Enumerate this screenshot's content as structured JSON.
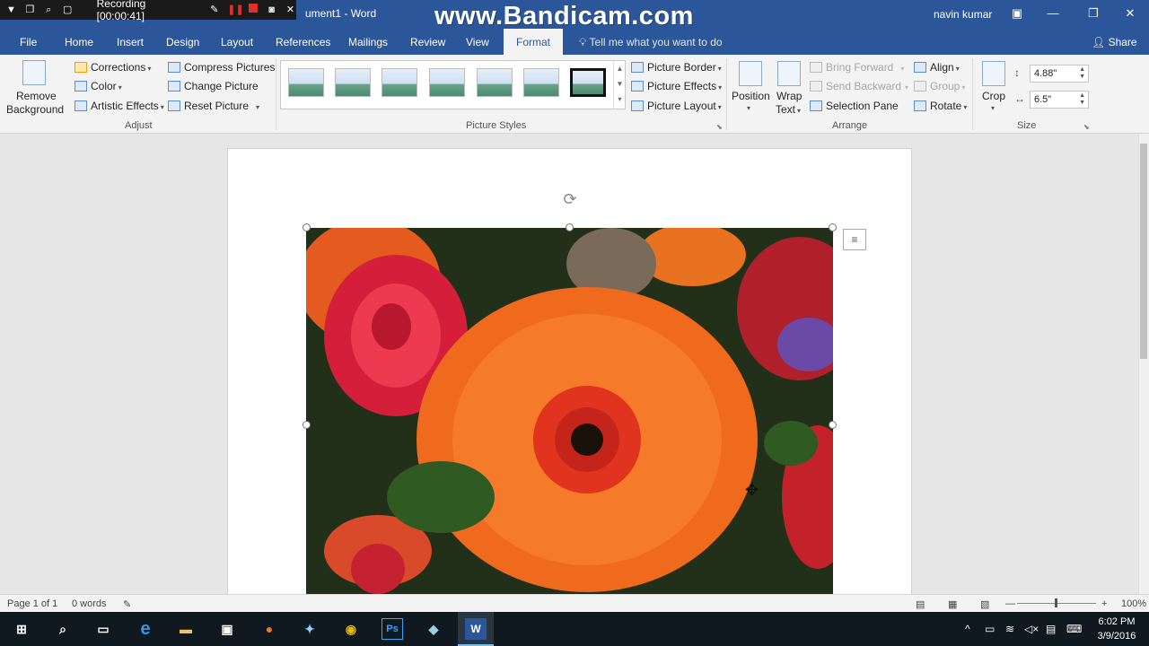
{
  "recorder": {
    "label": "Recording [00:00:41]"
  },
  "watermark": "www.Bandicam.com",
  "window": {
    "title": "ument1 - Word",
    "user": "navin kumar"
  },
  "tabs": [
    {
      "label": "File"
    },
    {
      "label": "Home"
    },
    {
      "label": "Insert"
    },
    {
      "label": "Design"
    },
    {
      "label": "Layout"
    },
    {
      "label": "References"
    },
    {
      "label": "Mailings"
    },
    {
      "label": "Review"
    },
    {
      "label": "View"
    },
    {
      "label": "Format"
    }
  ],
  "tell_me": "Tell me what you want to do",
  "share": "Share",
  "ribbon": {
    "remove_background": {
      "line1": "Remove",
      "line2": "Background"
    },
    "adjust": {
      "corrections": "Corrections",
      "color": "Color",
      "artistic_effects": "Artistic Effects",
      "compress_pictures": "Compress Pictures",
      "change_picture": "Change Picture",
      "reset_picture": "Reset Picture",
      "label": "Adjust"
    },
    "picture_styles": {
      "border": "Picture Border",
      "effects": "Picture Effects",
      "layout": "Picture Layout",
      "label": "Picture Styles"
    },
    "arrange": {
      "position": "Position",
      "wrap_line1": "Wrap",
      "wrap_line2": "Text",
      "bring_forward": "Bring Forward",
      "send_backward": "Send Backward",
      "selection_pane": "Selection Pane",
      "align": "Align",
      "group": "Group",
      "rotate": "Rotate",
      "label": "Arrange"
    },
    "size": {
      "crop": "Crop",
      "height": "4.88\"",
      "width": "6.5\"",
      "label": "Size"
    }
  },
  "status": {
    "page": "Page 1 of 1",
    "words": "0 words",
    "zoom": "100%"
  },
  "clock": {
    "time": "6:02 PM",
    "date": "3/9/2016"
  },
  "colors": {
    "word_blue": "#2b579a",
    "ribbon_bg": "#f3f3f3",
    "taskbar": "#101820"
  }
}
